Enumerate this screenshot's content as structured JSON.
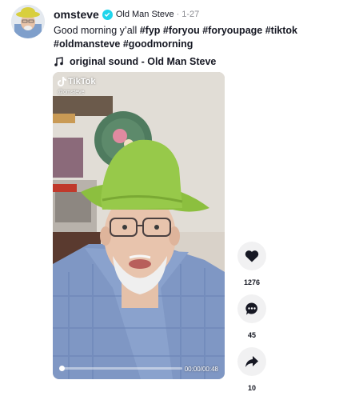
{
  "post": {
    "username": "omsteve",
    "nickname": "Old Man Steve",
    "separator": "·",
    "date": "1-27",
    "description_text": "Good morning y’all ",
    "hashtags": [
      "#fyp",
      "#foryou",
      "#foryoupage",
      "#tiktok",
      "#oldmansteve",
      "#goodmorning"
    ],
    "music": "original sound - Old Man Steve",
    "verified_icon": "verified-check-icon",
    "music_icon": "music-note-icon"
  },
  "video": {
    "watermark_brand": "TikTok",
    "watermark_handle": "@omsteve",
    "time": "00:00/00:48",
    "progress": 0
  },
  "actions": {
    "like": {
      "icon": "heart-icon",
      "count": "1276"
    },
    "comment": {
      "icon": "comment-icon",
      "count": "45"
    },
    "share": {
      "icon": "share-icon",
      "count": "10"
    }
  },
  "colors": {
    "verified": "#20d5ec",
    "text": "#161823",
    "muted": "#8a8b91",
    "action_bg": "#f1f1f2"
  }
}
